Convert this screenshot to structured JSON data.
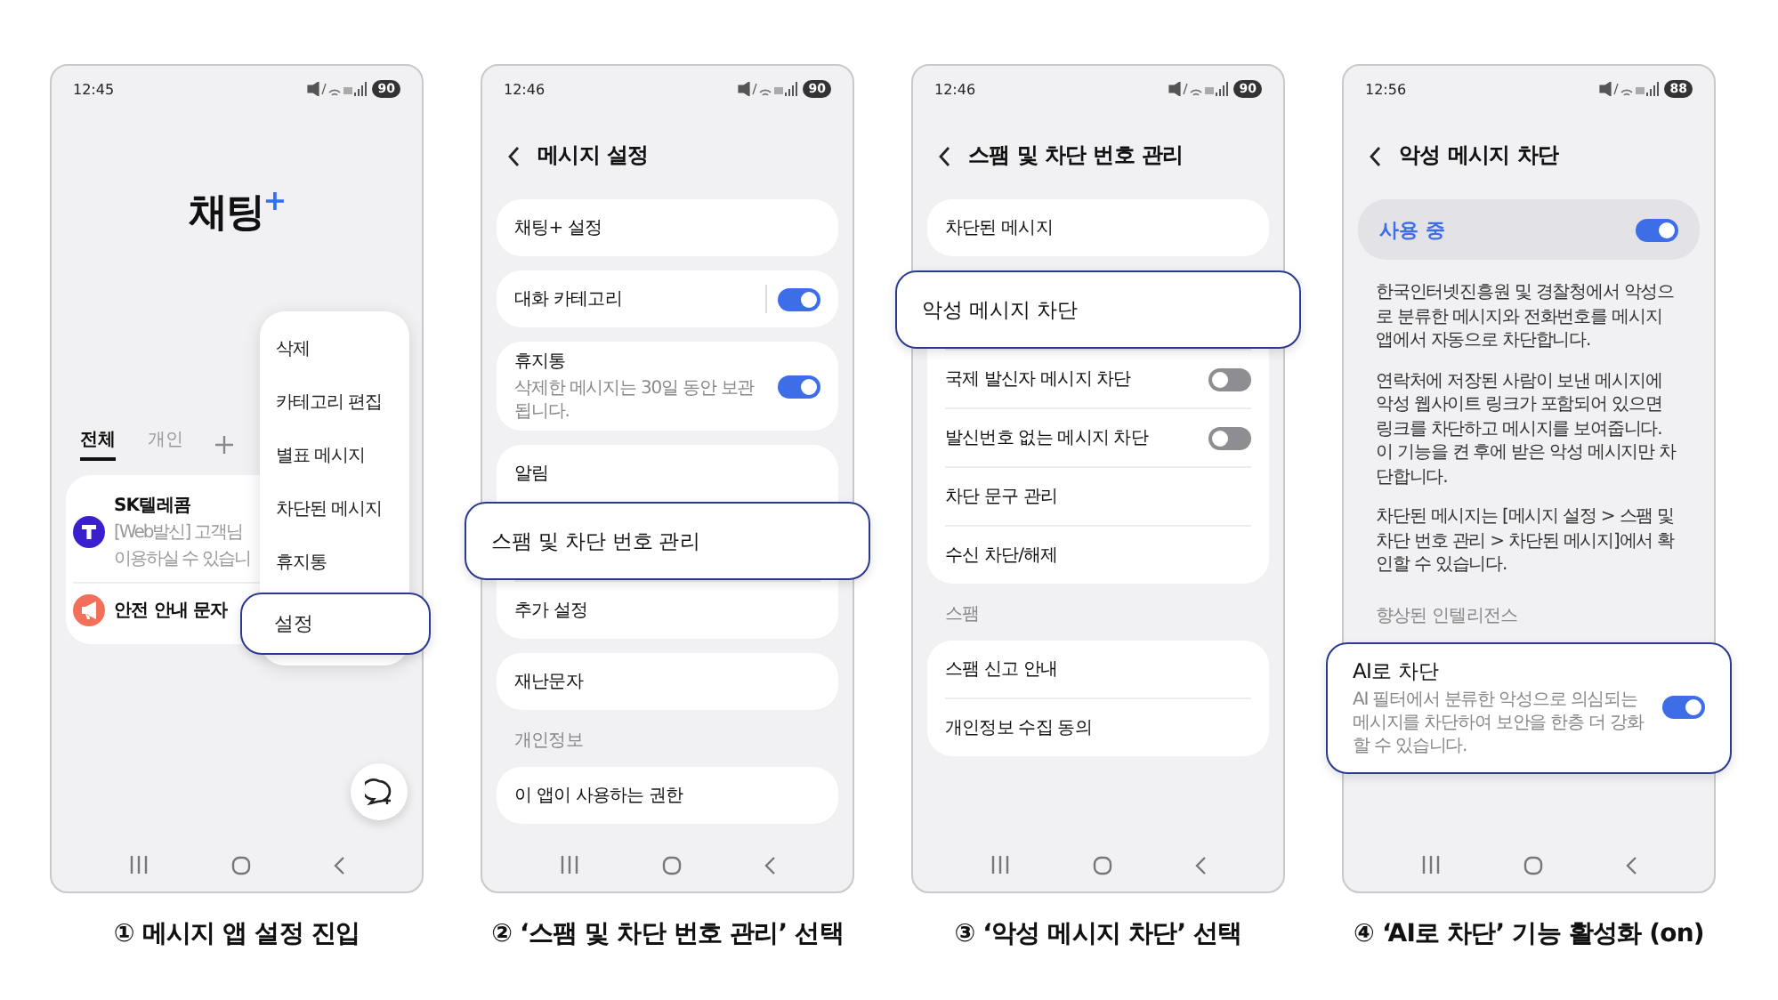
{
  "screens": [
    {
      "kind": "home",
      "time": "12:45",
      "battery": "90",
      "logo": {
        "text": "채팅",
        "mark": "+"
      },
      "tabs": [
        {
          "label": "전체",
          "selected": true
        },
        {
          "label": "개인",
          "selected": false
        }
      ],
      "chats": [
        {
          "kind": "brand",
          "name": "SK텔레콤",
          "preview": [
            "[Web발신] 고객님",
            "이용하실 수 있습니"
          ],
          "color": "#3a1fd0"
        },
        {
          "kind": "alert",
          "name": "안전 안내 문자",
          "color": "#f2705a"
        }
      ],
      "menu": [
        {
          "label": "삭제",
          "highlighted": false
        },
        {
          "label": "카테고리 편집",
          "highlighted": false
        },
        {
          "label": "별표 메시지",
          "highlighted": false
        },
        {
          "label": "차단된 메시지",
          "highlighted": false
        },
        {
          "label": "휴지통",
          "highlighted": false
        },
        {
          "label": "설정",
          "highlighted": true
        }
      ],
      "caption": "① 메시지 앱 설정 진입"
    },
    {
      "kind": "settings",
      "time": "12:46",
      "battery": "90",
      "title": "메시지 설정",
      "blocks": [
        {
          "kind": "card",
          "items": [
            {
              "label": "채팅+ 설정",
              "highlighted": false
            }
          ]
        },
        {
          "kind": "card",
          "items": [
            {
              "label": "대화 카테고리",
              "on": true,
              "split": true,
              "highlighted": false
            }
          ]
        },
        {
          "kind": "card",
          "items": [
            {
              "label": "휴지통",
              "sub": "삭제한 메시지는 30일 동안 보관됩니다.",
              "on": true,
              "highlighted": false
            }
          ]
        },
        {
          "kind": "card",
          "items": [
            {
              "label": "알림",
              "highlighted": false
            },
            {
              "label": "스팸 및 차단 번호 관리",
              "highlighted": true
            },
            {
              "label": "추가 설정",
              "highlighted": false
            }
          ]
        },
        {
          "kind": "card",
          "items": [
            {
              "label": "재난문자",
              "highlighted": false
            }
          ]
        },
        {
          "kind": "header",
          "text": "개인정보"
        },
        {
          "kind": "card",
          "items": [
            {
              "label": "이 앱이 사용하는 권한",
              "highlighted": false
            }
          ]
        },
        {
          "kind": "stub"
        }
      ],
      "caption": "② ‘스팸 및 차단 번호 관리’ 선택"
    },
    {
      "kind": "settings",
      "time": "12:46",
      "battery": "90",
      "title": "스팸 및 차단 번호 관리",
      "blocks": [
        {
          "kind": "card",
          "items": [
            {
              "label": "차단된 메시지",
              "highlighted": false
            }
          ]
        },
        {
          "kind": "card",
          "items": [
            {
              "label": "악성 메시지 차단",
              "highlighted": true
            },
            {
              "label": "국제 발신자 메시지 차단",
              "on": false,
              "highlighted": false
            },
            {
              "label": "발신번호 없는 메시지 차단",
              "on": false,
              "highlighted": false
            },
            {
              "label": "차단 문구 관리",
              "highlighted": false
            },
            {
              "label": "수신 차단/해제",
              "highlighted": false
            }
          ]
        },
        {
          "kind": "header",
          "text": "스팸"
        },
        {
          "kind": "card",
          "items": [
            {
              "label": "스팸 신고 안내",
              "highlighted": false
            },
            {
              "label": "개인정보 수집 동의",
              "highlighted": false
            }
          ]
        }
      ],
      "caption": "③ ‘악성 메시지 차단’ 선택"
    },
    {
      "kind": "settings",
      "time": "12:56",
      "battery": "88",
      "title": "악성 메시지 차단",
      "blocks": [
        {
          "kind": "master",
          "label": "사용 중",
          "on": true
        },
        {
          "kind": "notes",
          "paragraphs": [
            "한국인터넷진흥원 및 경찰청에서 악성으로 분류한 메시지와 전화번호를 메시지 앱에서 자동으로 차단합니다.",
            "연락처에 저장된 사람이 보낸 메시지에 악성 웹사이트 링크가 포함되어 있으면 링크를 차단하고 메시지를 보여줍니다. 이 기능을 켠 후에 받은 악성 메시지만 차단합니다.",
            "차단된 메시지는 [메시지 설정 > 스팸 및 차단 번호 관리 > 차단된 메시지]에서 확인할 수 있습니다."
          ]
        },
        {
          "kind": "header",
          "text": "향상된 인텔리전스"
        },
        {
          "kind": "card",
          "items": [
            {
              "label": "AI로 차단",
              "sub": "AI 필터에서 분류한 악성으로 의심되는 메시지를 차단하여 보안을 한층 더 강화할 수 있습니다.",
              "on": true,
              "highlighted": true
            }
          ]
        }
      ],
      "caption": "④ ‘AI로 차단’ 기능 활성화 (on)"
    }
  ]
}
